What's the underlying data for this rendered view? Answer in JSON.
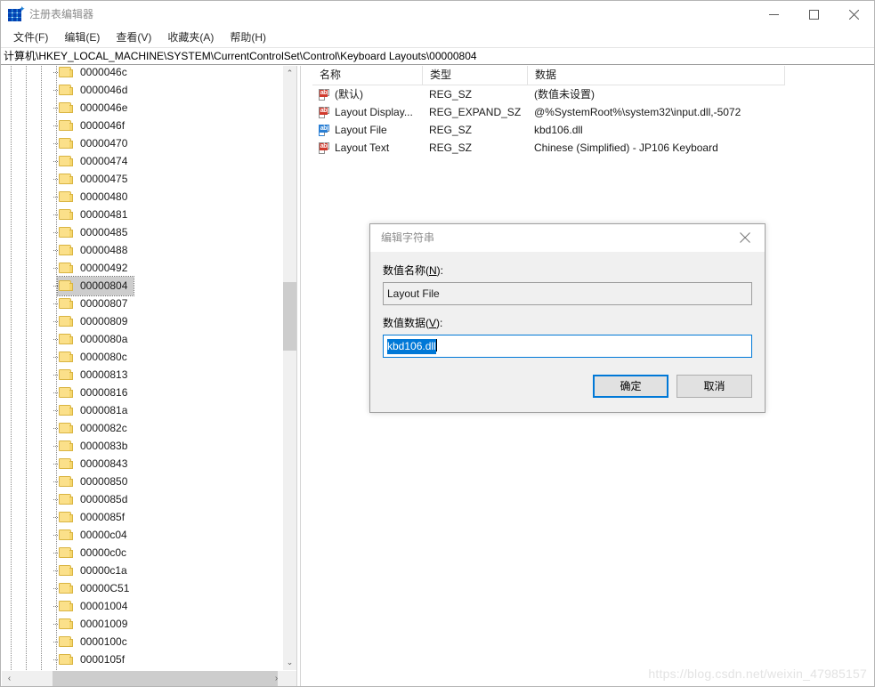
{
  "window": {
    "title": "注册表编辑器",
    "icon": "registry-editor-icon",
    "minimize_label": "—",
    "maximize_label": "□",
    "close_label": "✕"
  },
  "menubar": {
    "items": [
      {
        "label": "文件(F)"
      },
      {
        "label": "编辑(E)"
      },
      {
        "label": "查看(V)"
      },
      {
        "label": "收藏夹(A)"
      },
      {
        "label": "帮助(H)"
      }
    ]
  },
  "address": {
    "path": "计算机\\HKEY_LOCAL_MACHINE\\SYSTEM\\CurrentControlSet\\Control\\Keyboard Layouts\\00000804"
  },
  "tree": {
    "selected": "00000804",
    "items": [
      {
        "label": "0000046c",
        "selected": false
      },
      {
        "label": "0000046d",
        "selected": false
      },
      {
        "label": "0000046e",
        "selected": false
      },
      {
        "label": "0000046f",
        "selected": false
      },
      {
        "label": "00000470",
        "selected": false
      },
      {
        "label": "00000474",
        "selected": false
      },
      {
        "label": "00000475",
        "selected": false
      },
      {
        "label": "00000480",
        "selected": false
      },
      {
        "label": "00000481",
        "selected": false
      },
      {
        "label": "00000485",
        "selected": false
      },
      {
        "label": "00000488",
        "selected": false
      },
      {
        "label": "00000492",
        "selected": false
      },
      {
        "label": "00000804",
        "selected": true
      },
      {
        "label": "00000807",
        "selected": false
      },
      {
        "label": "00000809",
        "selected": false
      },
      {
        "label": "0000080a",
        "selected": false
      },
      {
        "label": "0000080c",
        "selected": false
      },
      {
        "label": "00000813",
        "selected": false
      },
      {
        "label": "00000816",
        "selected": false
      },
      {
        "label": "0000081a",
        "selected": false
      },
      {
        "label": "0000082c",
        "selected": false
      },
      {
        "label": "0000083b",
        "selected": false
      },
      {
        "label": "00000843",
        "selected": false
      },
      {
        "label": "00000850",
        "selected": false
      },
      {
        "label": "0000085d",
        "selected": false
      },
      {
        "label": "0000085f",
        "selected": false
      },
      {
        "label": "00000c04",
        "selected": false
      },
      {
        "label": "00000c0c",
        "selected": false
      },
      {
        "label": "00000c1a",
        "selected": false
      },
      {
        "label": "00000C51",
        "selected": false
      },
      {
        "label": "00001004",
        "selected": false
      },
      {
        "label": "00001009",
        "selected": false
      },
      {
        "label": "0000100c",
        "selected": false
      },
      {
        "label": "0000105f",
        "selected": false
      }
    ],
    "scroll_up_glyph": "⌃",
    "scroll_down_glyph": "⌄",
    "scroll_left_glyph": "‹",
    "scroll_right_glyph": "›"
  },
  "list": {
    "columns": [
      "名称",
      "类型",
      "数据"
    ],
    "rows": [
      {
        "name": "(默认)",
        "type": "REG_SZ",
        "data": "(数值未设置)",
        "selected": false
      },
      {
        "name": "Layout Display...",
        "type": "REG_EXPAND_SZ",
        "data": "@%SystemRoot%\\system32\\input.dll,-5072",
        "selected": false
      },
      {
        "name": "Layout File",
        "type": "REG_SZ",
        "data": "kbd106.dll",
        "selected": true
      },
      {
        "name": "Layout Text",
        "type": "REG_SZ",
        "data": "Chinese (Simplified) - JP106 Keyboard",
        "selected": false
      }
    ],
    "icon_text": "ab"
  },
  "dialog": {
    "title": "编辑字符串",
    "close_label": "✕",
    "name_label_pre": "数值名称(",
    "name_label_key": "N",
    "name_label_post": "):",
    "name_value": "Layout File",
    "data_label_pre": "数值数据(",
    "data_label_key": "V",
    "data_label_post": "):",
    "data_value": "kbd106.dll",
    "ok_label": "确定",
    "cancel_label": "取消",
    "accent_color": "#0078d7"
  },
  "watermark": {
    "text": "https://blog.csdn.net/weixin_47985157"
  }
}
